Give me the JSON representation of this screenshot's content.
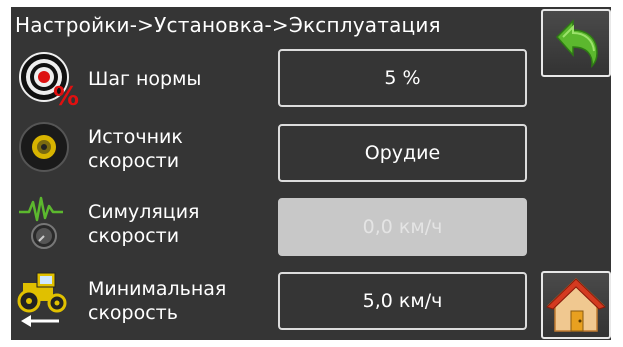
{
  "title": "Настройки->Установка->Эксплуатация",
  "rows": [
    {
      "icon": "target-percent-icon",
      "label": "Шаг нормы",
      "value": "5 %",
      "disabled": false
    },
    {
      "icon": "wheel-sensor-icon",
      "label_line1": "Источник",
      "label_line2": "скорости",
      "value": "Орудие",
      "disabled": false
    },
    {
      "icon": "speed-simulation-icon",
      "label_line1": "Симуляция",
      "label_line2": "скорости",
      "value": "0,0 км/ч",
      "disabled": true
    },
    {
      "icon": "tractor-reverse-icon",
      "label_line1": "Минимальная",
      "label_line2": "скорость",
      "value": "5,0 км/ч",
      "disabled": false
    }
  ],
  "buttons": {
    "back": "back-arrow-icon",
    "home": "home-icon"
  },
  "colors": {
    "background": "#353535",
    "accent_green": "#5cb82e",
    "disabled_field": "#c8c8c8"
  }
}
